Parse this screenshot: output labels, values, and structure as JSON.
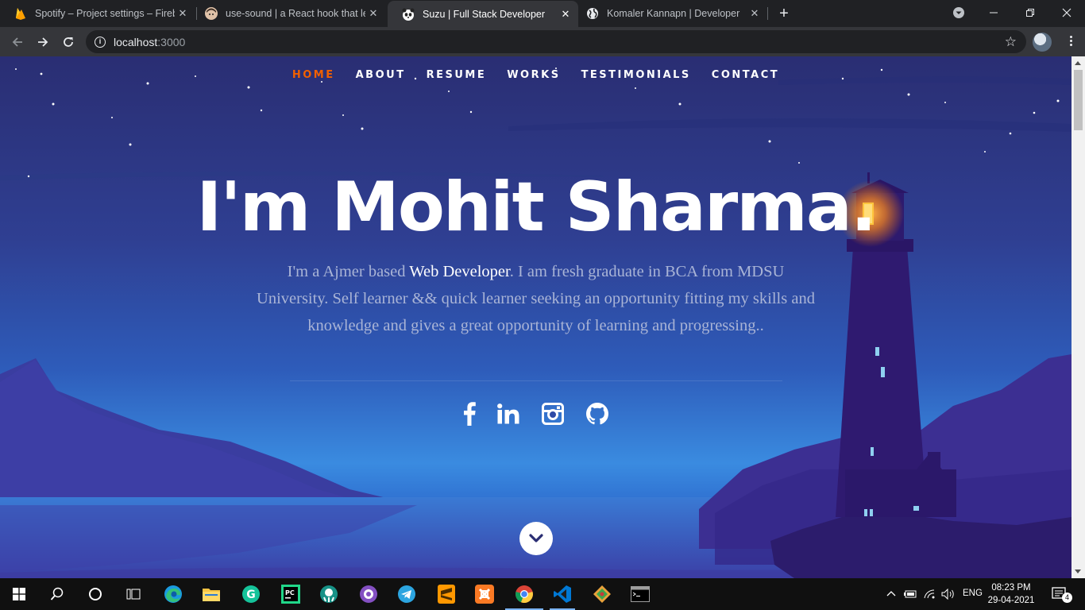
{
  "browser": {
    "tabs": [
      {
        "title": "Spotify – Project settings – Fireba",
        "icon": "firebase-icon",
        "active": false
      },
      {
        "title": "use-sound | a React hook that let",
        "icon": "avatar-icon",
        "active": false
      },
      {
        "title": "Suzu | Full Stack Developer",
        "icon": "panda-icon",
        "active": true
      },
      {
        "title": "Komaler Kannapn | Developer",
        "icon": "globe-icon",
        "active": false
      }
    ],
    "close_glyph": "✕",
    "new_tab_glyph": "+",
    "address": {
      "host": "localhost",
      "port": ":3000"
    }
  },
  "site": {
    "nav": [
      {
        "label": "HOME",
        "active": true
      },
      {
        "label": "ABOUT",
        "active": false
      },
      {
        "label": "RESUME",
        "active": false
      },
      {
        "label": "WORKS",
        "active": false
      },
      {
        "label": "TESTIMONIALS",
        "active": false
      },
      {
        "label": "CONTACT",
        "active": false
      }
    ],
    "hero": {
      "title": "I'm Mohit Sharma.",
      "intro_before": "I'm a Ajmer based ",
      "intro_highlight": "Web Developer",
      "intro_after": ". I am fresh graduate in BCA from MDSU University. Self learner && quick learner seeking an opportunity fitting my skills and knowledge and gives a great opportunity of learning and progressing.."
    },
    "social": [
      "facebook-icon",
      "linkedin-icon",
      "instagram-icon",
      "github-icon"
    ],
    "accent_color": "#f06000"
  },
  "taskbar": {
    "apps": [
      "start",
      "search",
      "cortana",
      "task-view",
      "edge",
      "file-explorer",
      "grammarly",
      "pycharm",
      "gitkraken",
      "github-desktop",
      "telegram",
      "sublime-text",
      "xampp",
      "chrome",
      "vscode",
      "git-extensions",
      "terminal"
    ],
    "language": "ENG",
    "time": "08:23 PM",
    "date": "29-04-2021",
    "notifications": "4"
  }
}
